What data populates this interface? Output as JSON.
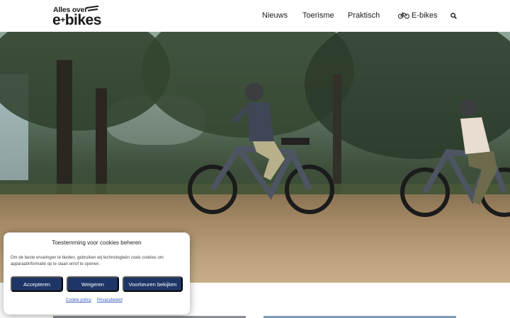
{
  "header": {
    "logo_top": "Alles over",
    "logo_bottom_prefix": "e",
    "logo_plus": "+",
    "logo_bottom_suffix": "bikes",
    "nav": [
      {
        "label": "Nieuws"
      },
      {
        "label": "Toerisme"
      },
      {
        "label": "Praktisch"
      },
      {
        "label": "E-bikes",
        "icon": "bicycle-icon"
      }
    ],
    "search_icon": "search-icon"
  },
  "hero": {
    "image": "two cyclists riding e-bikes along a forest path"
  },
  "cookie_banner": {
    "title": "Toestemming voor cookies beheren",
    "text": "Om de beste ervaringen te bieden, gebruiken wij technologieën zoals cookies om apparaatinformatie op te slaan en/of te openen.",
    "accept_label": "Accepteren",
    "deny_label": "Weigeren",
    "preferences_label": "Voorkeuren bekijken",
    "links": [
      "Cookie policy",
      "Privacybeleid"
    ],
    "button_color": "#1e3567"
  }
}
